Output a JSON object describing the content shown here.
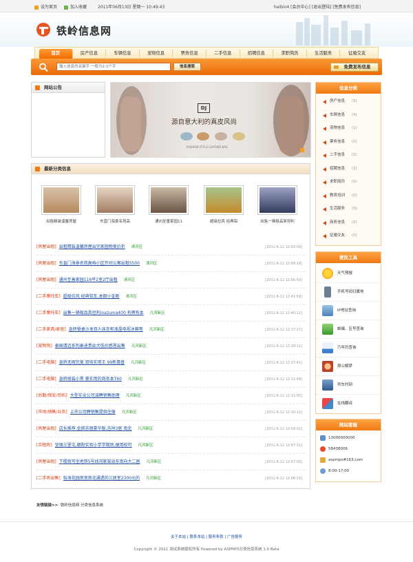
{
  "topbar": {
    "set_home": "设为首页",
    "add_fav": "加入收藏",
    "datetime": "2011年06月13日 星期一 10:49:43",
    "user_links": "haibin4 [会员中心] [退出登陆] [免费发布信息]"
  },
  "site": {
    "name": "铁岭信息网"
  },
  "nav": [
    "首页",
    "房产信息",
    "车辆信息",
    "宠物信息",
    "票务信息",
    "二手信息",
    "招聘信息",
    "求职简历",
    "生活服务",
    "征婚交友"
  ],
  "search": {
    "placeholder": "输入信息的关键字 一般为2-3个字",
    "button": "信息搜索",
    "free_post": "免费发布信息"
  },
  "announce": {
    "title": "网站公告"
  },
  "banner": {
    "headline": "源自意大利的真皮风尚",
    "brand": "DJ",
    "subtext": "FASHION STYLE LEATHER BAG"
  },
  "latest": {
    "title": "最新分类信息",
    "thumbs": [
      {
        "caption": "出租精装温馨房屋"
      },
      {
        "caption": "东直门海景名苑高"
      },
      {
        "caption": "通州至善家园11"
      },
      {
        "caption": "超级拉风 经典铝"
      },
      {
        "caption": "出售一辆极品英坦利"
      }
    ],
    "rows": [
      {
        "cat": "[房屋出租]",
        "title": "出租精装温馨房屋出完家园物美价折",
        "region": "清河区",
        "date": "[2011-6-12 12:59:09]"
      },
      {
        "cat": "[房屋出租]",
        "title": "东直门海景名苑高档小区开间公寓出租5500",
        "region": "清河区",
        "date": "[2011-6-12 12:58:18]"
      },
      {
        "cat": "[房屋出租]",
        "title": "通州至善家园116平2室2厅出租",
        "region": "清河区",
        "date": "[2011-6-12 12:56:50]"
      },
      {
        "cat": "[二手摩托车]",
        "title": "超级拉风 经典铝车,本田小金刚",
        "region": "清河区",
        "date": "[2011-6-12 12:41:59]"
      },
      {
        "cat": "[二手摩托车]",
        "title": "出售一辆极品英坦利inazuma400 有牌有本",
        "region": "凡河新区",
        "date": "[2011-6-12 12:40:12]"
      },
      {
        "cat": "[二手家具/家居]",
        "title": "急转餐桌沙发双人床衣柜液晶电视冰箱等",
        "region": "凡河新区",
        "date": "[2011-6-12 12:37:27]"
      },
      {
        "cat": "[宠物狗]",
        "title": "泰国清迈系列泰迪贵幼犬低价感恩出售",
        "region": "凡河新区",
        "date": "[2011-6-12 12:28:11]"
      },
      {
        "cat": "[二手电脑]",
        "title": "急转无瑕完美 双核实用王 99新惠普",
        "region": "凡河新区",
        "date": "[2011-6-12 12:27:41]"
      },
      {
        "cat": "[二手电脑]",
        "title": "急转原装小黑 豪实用的商务本T60",
        "region": "凡河新区",
        "date": "[2011-6-12 12:11:48]"
      },
      {
        "cat": "[后勤/保安/司机]",
        "title": "大型实业公司诚聘销售助理",
        "region": "凡河新区",
        "date": "[2011-6-12 12:11:05]"
      },
      {
        "cat": "[市场/销售/业务]",
        "title": "上市公司聘销售提供住宿",
        "region": "凡河新区",
        "date": "[2011-6-12 12:10:12]"
      },
      {
        "cat": "[房屋出租]",
        "title": "店长推荐,金辰苏丽豪华版,吉祥3居 南北",
        "region": "凡河新区",
        "date": "[2011-6-12 12:09:02]"
      },
      {
        "cat": "[合租房]",
        "title": "坚强三里屯,朝阳实验小学学期房,便用权可",
        "region": "凡河新区",
        "date": "[2011-6-12 12:07:31]"
      },
      {
        "cat": "[房屋出租]",
        "title": "下楼就可坐地铁5号线刘家窑站东南向大二居",
        "region": "凡河新区",
        "date": "[2011-6-12 12:07:00]"
      },
      {
        "cat": "[二手房出售]",
        "title": "怡海花园南宽南北通透的三居室2300元的",
        "region": "凡河新区",
        "date": "[2011-6-12 12:06:33]"
      }
    ]
  },
  "categories": {
    "title": "信息分类",
    "items": [
      {
        "label": "房产信息",
        "count": "(9)"
      },
      {
        "label": "车辆信息",
        "count": "(4)"
      },
      {
        "label": "宠物信息",
        "count": "(1)"
      },
      {
        "label": "票务信息",
        "count": "(0)"
      },
      {
        "label": "二手信息",
        "count": "(0)"
      },
      {
        "label": "招聘信息",
        "count": "(2)"
      },
      {
        "label": "求职简历",
        "count": "(0)"
      },
      {
        "label": "教育培训",
        "count": "(0)"
      },
      {
        "label": "生活服务",
        "count": "(0)"
      },
      {
        "label": "商务信息",
        "count": "(0)"
      },
      {
        "label": "征婚交友",
        "count": "(0)"
      }
    ]
  },
  "tools": {
    "title": "便民工具",
    "items": [
      {
        "label": "天气预报",
        "icon": "sun-icon"
      },
      {
        "label": "手机号码归属地",
        "icon": "phone-icon"
      },
      {
        "label": "IP地址查询",
        "icon": "ip-icon"
      },
      {
        "label": "邮编、区号查询",
        "icon": "mail-icon"
      },
      {
        "label": "万年历查询",
        "icon": "calendar-icon"
      },
      {
        "label": "周公解梦",
        "icon": "dream-icon"
      },
      {
        "label": "列车时刻",
        "icon": "train-icon"
      },
      {
        "label": "在线翻译",
        "icon": "translate-icon"
      }
    ]
  },
  "service": {
    "title": "网站客服",
    "phone": "13000000000",
    "qq": "58438006",
    "email": "aspmps#163.com",
    "hours": "8:00-17:00"
  },
  "links": {
    "label": "友情链接>>",
    "items": "铁岭信息网  分类信息系统"
  },
  "footer": {
    "links": "关于本站  |  联系本站  |  服务条款  |  广告服务",
    "copyright": "Copyright © 2011 测试系统版权所有 Powered by ASPMPS分类信息系统 1.0 Beta"
  },
  "colors": {
    "accent": "#f07a13",
    "link": "#1b4ea0",
    "category": "#e23b0f",
    "region": "#2b9a2b"
  }
}
